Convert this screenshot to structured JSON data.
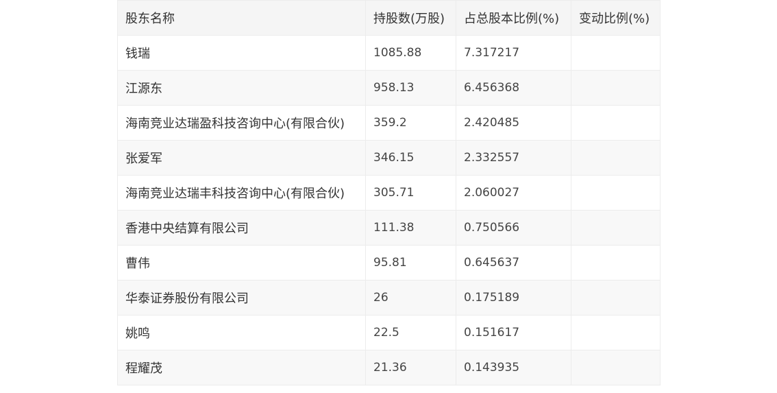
{
  "table": {
    "headers": [
      "股东名称",
      "持股数(万股)",
      "占总股本比例(%)",
      "变动比例(%)"
    ],
    "rows": [
      [
        "钱瑞",
        "1085.88",
        "7.317217",
        ""
      ],
      [
        "江源东",
        "958.13",
        "6.456368",
        ""
      ],
      [
        "海南竞业达瑞盈科技咨询中心(有限合伙)",
        "359.2",
        "2.420485",
        ""
      ],
      [
        "张爱军",
        "346.15",
        "2.332557",
        ""
      ],
      [
        "海南竞业达瑞丰科技咨询中心(有限合伙)",
        "305.71",
        "2.060027",
        ""
      ],
      [
        "香港中央结算有限公司",
        "111.38",
        "0.750566",
        ""
      ],
      [
        "曹伟",
        "95.81",
        "0.645637",
        ""
      ],
      [
        "华泰证券股份有限公司",
        "26",
        "0.175189",
        ""
      ],
      [
        "姚鸣",
        "22.5",
        "0.151617",
        ""
      ],
      [
        "程耀茂",
        "21.36",
        "0.143935",
        ""
      ]
    ]
  }
}
